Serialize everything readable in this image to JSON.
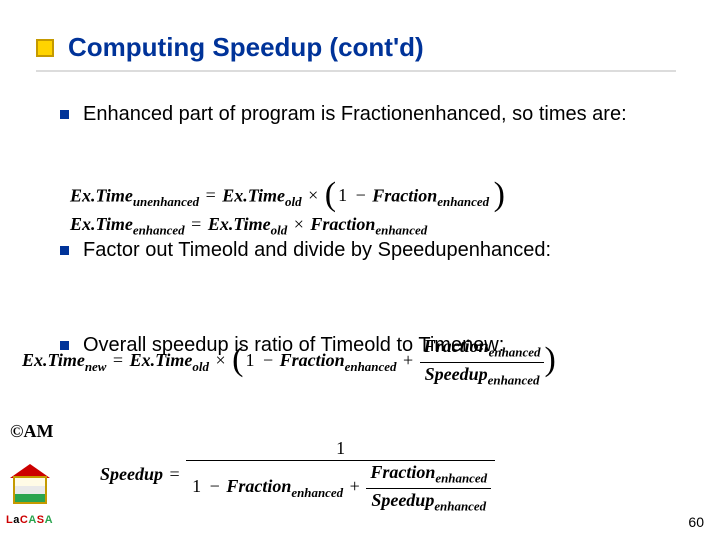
{
  "title": "Computing Speedup (cont'd)",
  "bullets": [
    "Enhanced part of program is Fractionenhanced, so times are:",
    "Factor out Timeold and divide by Speedupenhanced:",
    "Overall speedup is ratio of Timeold to Timenew:"
  ],
  "equations": {
    "eq1": {
      "lhs_base": "Ex.Time",
      "lhs_sub": "unenhanced",
      "rhs1_base": "Ex.Time",
      "rhs1_sub": "old",
      "one": "1",
      "minus": "−",
      "times": "×",
      "eq": "=",
      "frac_base": "Fraction",
      "frac_sub": "enhanced"
    },
    "eq2": {
      "lhs_base": "Ex.Time",
      "lhs_sub": "enhanced",
      "rhs1_base": "Ex.Time",
      "rhs1_sub": "old",
      "times": "×",
      "eq": "=",
      "frac_base": "Fraction",
      "frac_sub": "enhanced"
    },
    "eq3": {
      "lhs_base": "Ex.Time",
      "lhs_sub": "new",
      "rhs1_base": "Ex.Time",
      "rhs1_sub": "old",
      "one": "1",
      "minus": "−",
      "plus": "+",
      "times": "×",
      "eq": "=",
      "f_base": "Fraction",
      "f_sub": "enhanced",
      "s_base": "Speedup",
      "s_sub": "enhanced"
    },
    "eq4": {
      "lhs": "Speedup",
      "eq": "=",
      "one": "1",
      "minus": "−",
      "plus": "+",
      "f_base": "Fraction",
      "f_sub": "enhanced",
      "s_base": "Speedup",
      "s_sub": "enhanced"
    }
  },
  "marks": {
    "am": "©AM"
  },
  "lacasa": {
    "L": "L",
    "a1": "a",
    "C": "C",
    "A": "A",
    "S": "S",
    "A2": "A"
  },
  "page_number": "60"
}
